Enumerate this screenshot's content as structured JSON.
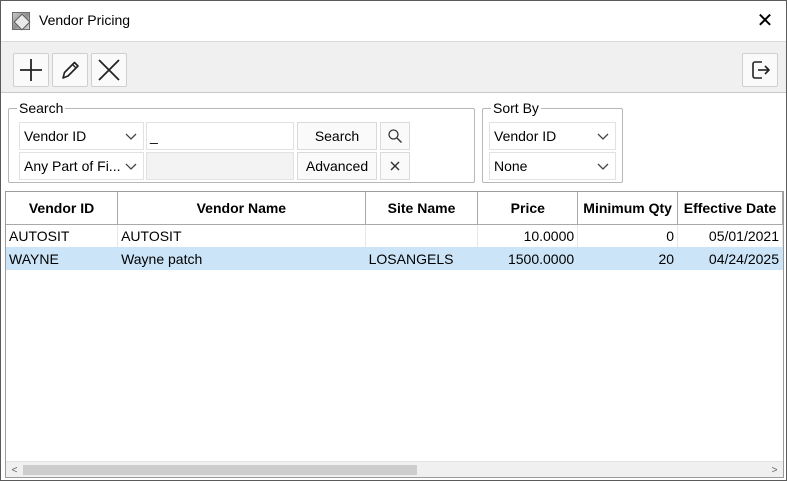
{
  "window": {
    "title": "Vendor Pricing",
    "close_glyph": "✕",
    "app_icon": "vendor-pricing-app-icon"
  },
  "toolbar": {
    "buttons": [
      {
        "name": "add-button",
        "icon": "plus-icon"
      },
      {
        "name": "edit-button",
        "icon": "pencil-icon"
      },
      {
        "name": "delete-button",
        "icon": "x-icon"
      }
    ],
    "exit_button": {
      "name": "exit-button",
      "icon": "exit-icon"
    }
  },
  "search": {
    "label": "Search",
    "field_select": "Vendor ID",
    "text_value": "_",
    "match_select": "Any Part of Fi...",
    "search_button": "Search",
    "advanced_button": "Advanced",
    "search_icon": "magnifier-icon",
    "clear_icon": "clear-x-icon"
  },
  "sort": {
    "label": "Sort By",
    "primary": "Vendor ID",
    "secondary": "None"
  },
  "grid": {
    "columns": [
      "Vendor ID",
      "Vendor Name",
      "Site Name",
      "Price",
      "Minimum Qty",
      "Effective Date"
    ],
    "rows": [
      {
        "vendor_id": "AUTOSIT",
        "vendor_name": "AUTOSIT",
        "site_name": "",
        "price": "10.0000",
        "min_qty": "0",
        "effective_date": "05/01/2021"
      },
      {
        "vendor_id": "WAYNE",
        "vendor_name": "Wayne patch",
        "site_name": "LOSANGELS",
        "price": "1500.0000",
        "min_qty": "20",
        "effective_date": "04/24/2025"
      }
    ],
    "selected_row_index": 1,
    "scroll": {
      "left_arrow": "<",
      "right_arrow": ">"
    }
  },
  "colors": {
    "selection": "#cce4f7",
    "toolbar_bg": "#f0f0f0",
    "border": "#a9a9a9"
  }
}
